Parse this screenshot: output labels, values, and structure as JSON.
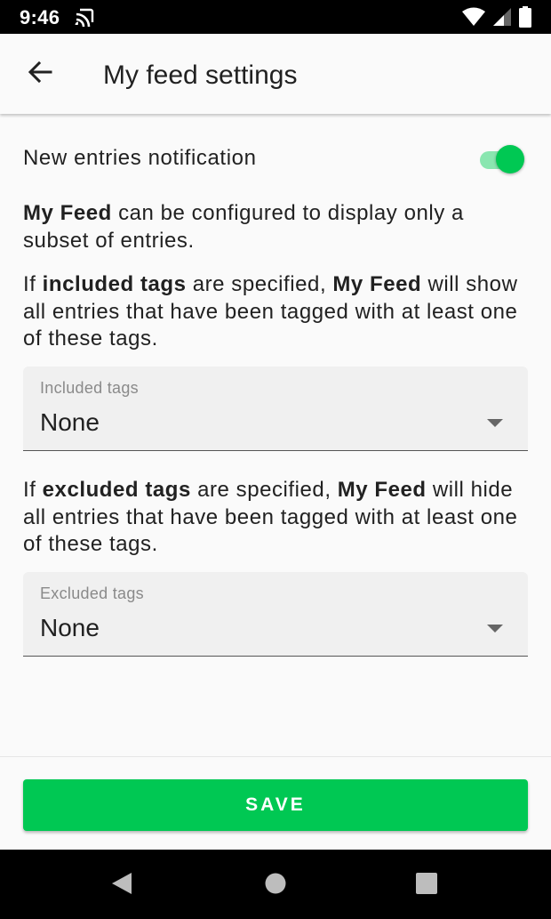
{
  "status_bar": {
    "time": "9:46",
    "icons": [
      "cast-icon",
      "wifi-icon",
      "signal-icon",
      "battery-icon"
    ]
  },
  "app_bar": {
    "back_icon": "arrow-left-icon",
    "title": "My feed settings"
  },
  "settings": {
    "notification_label": "New entries notification",
    "notification_enabled": true,
    "accent_color": "#00c853"
  },
  "intro": {
    "bold": "My Feed",
    "rest": " can be configured to display only a subset of entries."
  },
  "included_info": {
    "t1": "If ",
    "b1": "included tags",
    "t2": " are specified, ",
    "b2": "My Feed",
    "t3": " will show all entries that have been tagged with at least one of these tags."
  },
  "included_select": {
    "label": "Included tags",
    "value": "None"
  },
  "excluded_info": {
    "t1": "If ",
    "b1": "excluded tags",
    "t2": " are specified, ",
    "b2": "My Feed",
    "t3": " will hide all entries that have been tagged with at least one of these tags."
  },
  "excluded_select": {
    "label": "Excluded tags",
    "value": "None"
  },
  "actions": {
    "save_label": "SAVE"
  },
  "nav_bar": {
    "icons": [
      "back-triangle-icon",
      "home-circle-icon",
      "recents-square-icon"
    ]
  }
}
